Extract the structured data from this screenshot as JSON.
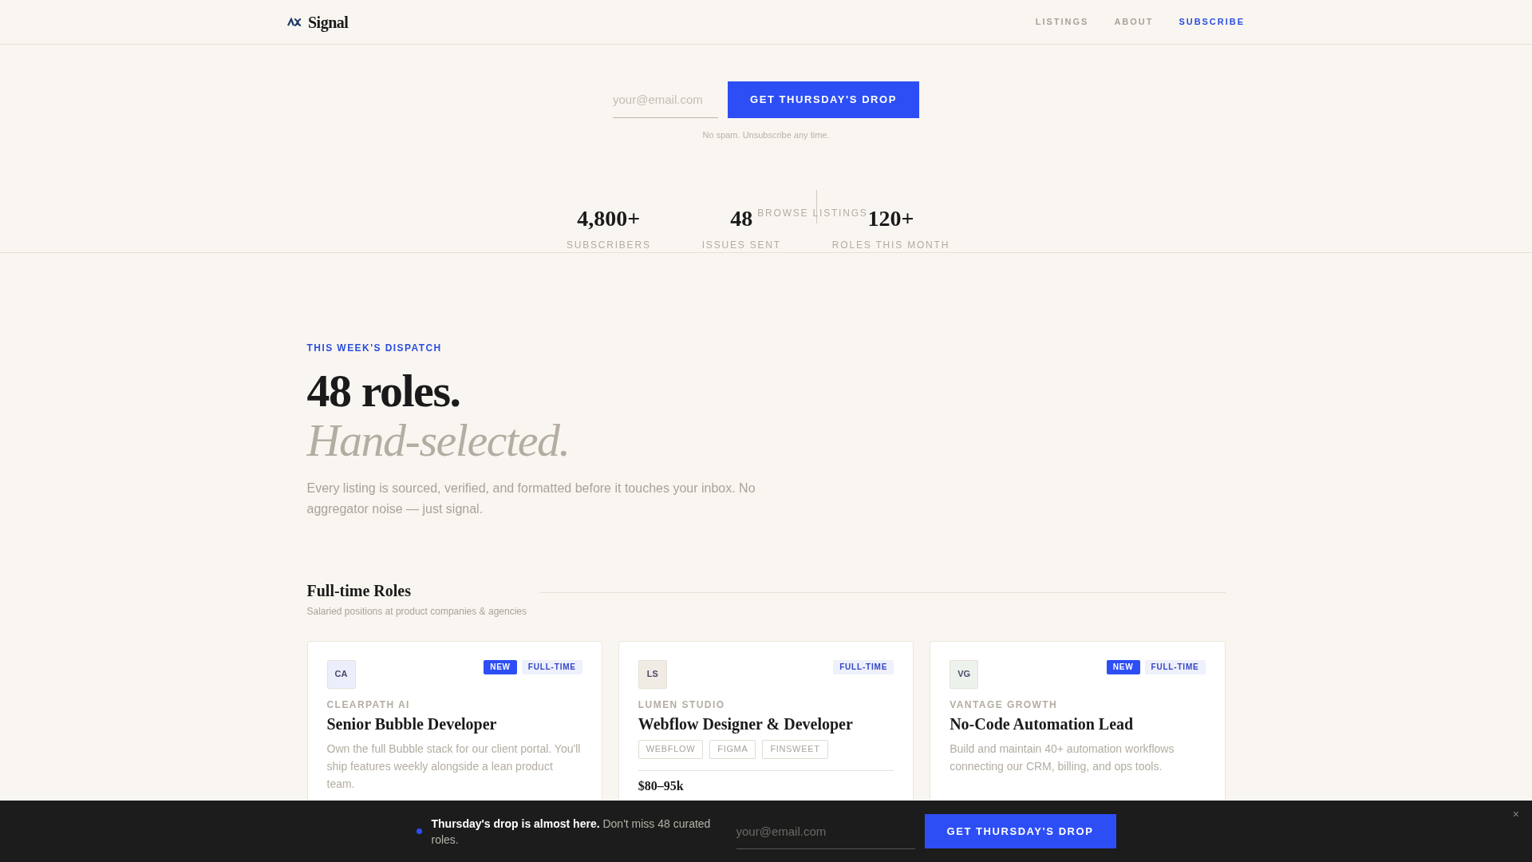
{
  "nav": {
    "brand": "Signal",
    "links": [
      {
        "label": "LISTINGS",
        "selected": false
      },
      {
        "label": "ABOUT",
        "selected": false
      },
      {
        "label": "SUBSCRIBE",
        "selected": true
      }
    ]
  },
  "hero_form": {
    "placeholder": "your@email.com",
    "button": "GET THURSDAY'S DROP",
    "note": "No spam. Unsubscribe any time."
  },
  "stats": [
    {
      "value": "4,800+",
      "label": "SUBSCRIBERS"
    },
    {
      "value": "48",
      "label": "ISSUES SENT"
    },
    {
      "value": "120+",
      "label": "ROLES THIS MONTH"
    }
  ],
  "browse_link": "BROWSE LISTINGS",
  "dispatch": {
    "eyebrow": "THIS WEEK'S DISPATCH",
    "headline": "48 roles.",
    "subheadline": "Hand-selected.",
    "body": "Every listing is sourced, verified, and formatted before it touches your inbox. No aggregator noise — just signal."
  },
  "section": {
    "title": "Full-time Roles",
    "subtitle": "Salaried positions at product companies & agencies"
  },
  "cards": [
    {
      "initials": "CA",
      "color": "#eceefb",
      "company": "CLEARPATH AI",
      "title": "Senior Bubble Developer",
      "new_label": "NEW",
      "type": "FULL-TIME",
      "description": "Own the full Bubble stack for our client portal. You'll ship features weekly alongside a lean product team."
    },
    {
      "initials": "LS",
      "color": "#f1ece3",
      "company": "LUMEN STUDIO",
      "title": "Webflow Designer & Developer",
      "type": "FULL-TIME",
      "tags": [
        "WEBFLOW",
        "FIGMA",
        "FINSWEET"
      ],
      "salary": "$80–95k"
    },
    {
      "initials": "VG",
      "color": "#edf2ec",
      "company": "VANTAGE GROWTH",
      "title": "No-Code Automation Lead",
      "new_label": "NEW",
      "type": "FULL-TIME",
      "description": "Build and maintain 40+ automation workflows connecting our CRM, billing, and ops tools."
    }
  ],
  "bottom_bar": {
    "bold": "Thursday's drop is almost here.",
    "text": "Don't miss 48 curated roles.",
    "placeholder": "your@email.com",
    "button": "GET THURSDAY'S DROP",
    "close": "×"
  }
}
